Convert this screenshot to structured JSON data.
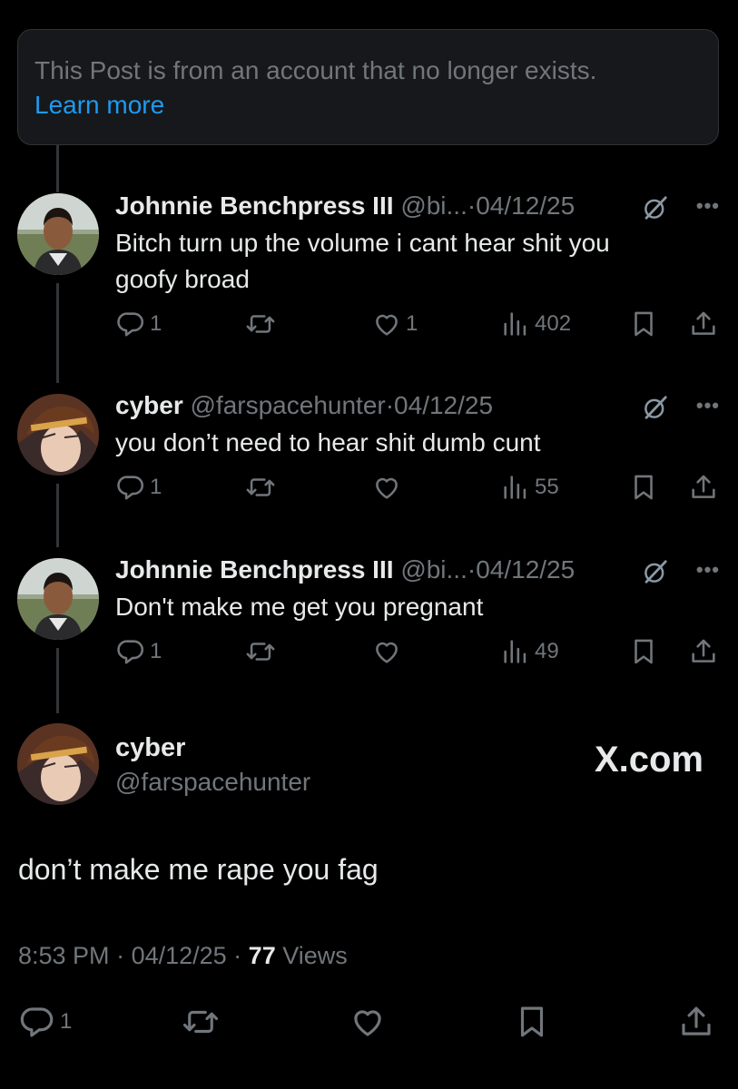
{
  "banner": {
    "text": "This Post is from an account that no longer exists.",
    "link": "Learn more"
  },
  "posts": [
    {
      "name": "Johnnie Benchpress III",
      "handle": "@bi...",
      "dot": "·",
      "date": "04/12/25",
      "lines": [
        "Bitch turn up the volume i cant hear shit you",
        "goofy broad"
      ],
      "replies": "1",
      "likes": "1",
      "views": "402"
    },
    {
      "name": "cyber",
      "handle": "@farspacehunter",
      "dot": "·",
      "date": "04/12/25",
      "lines": [
        "you don’t need to hear shit dumb cunt"
      ],
      "replies": "1",
      "likes": "",
      "views": "55"
    },
    {
      "name": "Johnnie Benchpress III",
      "handle": "@bi...",
      "dot": "·",
      "date": "04/12/25",
      "lines": [
        "Don't make me get you pregnant"
      ],
      "replies": "1",
      "likes": "",
      "views": "49"
    }
  ],
  "main": {
    "name": "cyber",
    "handle": "@farspacehunter",
    "watermark": "X.com",
    "text": "don’t make me rape you fag",
    "time": "8:53 PM",
    "date": "04/12/25",
    "views_count": "77",
    "views_label": "Views",
    "replies": "1"
  },
  "icons": [
    "reply-icon",
    "repost-icon",
    "like-icon",
    "views-icon",
    "bookmark-icon",
    "share-icon",
    "grok-icon",
    "more-icon"
  ]
}
